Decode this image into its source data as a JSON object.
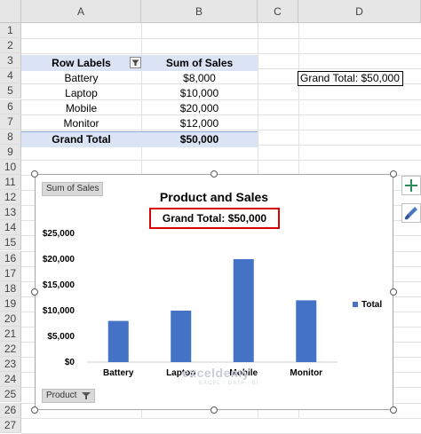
{
  "columns": [
    "A",
    "B",
    "C",
    "D"
  ],
  "rows": [
    "1",
    "2",
    "3",
    "4",
    "5",
    "6",
    "7",
    "8",
    "9",
    "10",
    "11",
    "12",
    "13",
    "14",
    "15",
    "16",
    "17",
    "18",
    "19",
    "20",
    "21",
    "22",
    "23",
    "24",
    "25",
    "26",
    "27"
  ],
  "pivot": {
    "header_row_labels": "Row Labels",
    "header_sum": "Sum of Sales",
    "items": [
      {
        "label": "Battery",
        "value": "$8,000"
      },
      {
        "label": "Laptop",
        "value": "$10,000"
      },
      {
        "label": "Mobile",
        "value": "$20,000"
      },
      {
        "label": "Monitor",
        "value": "$12,000"
      }
    ],
    "total_label": "Grand Total",
    "total_value": "$50,000"
  },
  "grand_total_cell": "Grand Total: $50,000",
  "chart_buttons": {
    "value_field": "Sum of Sales",
    "axis_field": "Product"
  },
  "watermark": {
    "main": "exceldemy",
    "sub": "EXCEL · DATA · BI"
  },
  "chart_data": {
    "type": "bar",
    "title": "Product and Sales",
    "subtitle": "Grand Total: $50,000",
    "categories": [
      "Battery",
      "Laptop",
      "Mobile",
      "Monitor"
    ],
    "series": [
      {
        "name": "Total",
        "values": [
          8000,
          10000,
          20000,
          12000
        ],
        "color": "#4472c4"
      }
    ],
    "yticks": [
      "$0",
      "$5,000",
      "$10,000",
      "$15,000",
      "$20,000",
      "$25,000"
    ],
    "ylim": [
      0,
      25000
    ],
    "grid": false,
    "legend": "right"
  }
}
